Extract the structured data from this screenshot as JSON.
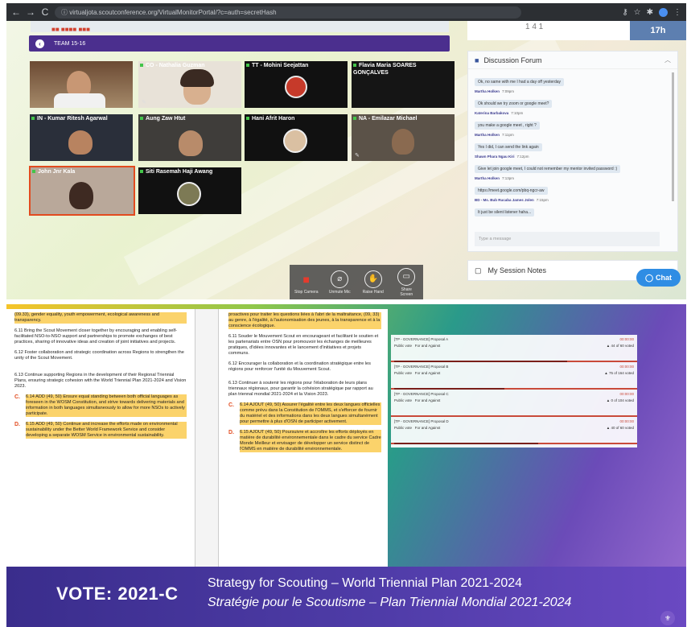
{
  "browser": {
    "back": "←",
    "forward": "→",
    "reload": "C",
    "url": "ⓘ virtualjota.scoutconference.org/VirtualMonitorPortal/?c=auth=secretHash",
    "icons": [
      "key-icon",
      "star-icon",
      "extensions-icon",
      "profile-icon",
      "menu-icon"
    ]
  },
  "top_strip": {
    "text": "■■ ■■■■ ■■■"
  },
  "team_bar": {
    "label": "TEAM 15-16"
  },
  "tiles": [
    {
      "name": "",
      "active": false
    },
    {
      "name": "CO - Nathalia Guzman",
      "active": false
    },
    {
      "name": "TT - Mohini Seejattan",
      "active": false
    },
    {
      "name": "Flavia Maria SOARES GONÇALVES",
      "active": false
    },
    {
      "name": "IN - Kumar Ritesh Agarwal",
      "active": false
    },
    {
      "name": "Aung Zaw Htut",
      "active": false
    },
    {
      "name": "Hani Afrit Haron",
      "active": false
    },
    {
      "name": "NA - Emilazar Michael",
      "active": false
    },
    {
      "name": "John Jnr Kala",
      "active": true
    },
    {
      "name": "Siti Rasemah Haji Awang",
      "active": false
    }
  ],
  "controls": [
    {
      "label": "Stop Camera",
      "icon": "camera-icon"
    },
    {
      "label": "Unmute Mic",
      "icon": "mic-off-icon"
    },
    {
      "label": "Raise Hand",
      "icon": "hand-icon"
    },
    {
      "label": "Share Screen",
      "icon": "screen-icon"
    }
  ],
  "stats": {
    "left": "1 4 1",
    "right": "17h"
  },
  "forum": {
    "title": "Discussion Forum",
    "messages": [
      {
        "who": "",
        "time": "",
        "text": "Ok, no same with me I had a day off yesterday"
      },
      {
        "who": "Martha Holken",
        "time": "7:09pm",
        "text": "Ok should we try zoom or google meet?"
      },
      {
        "who": "Katerina Barbakova",
        "time": "7:10pm",
        "text": "you make a google meet , right ?"
      },
      {
        "who": "Martha Holken",
        "time": "7:11pm",
        "text": "Yes I did, I can send the link again"
      },
      {
        "who": "Shawn Phara Ngau Kiri",
        "time": "7:12pm",
        "text": "Give let join google meet, I could not remember my mentor invited password :)"
      },
      {
        "who": "Martha Holken",
        "time": "7:13pm",
        "text": "https://meet.google.com/pbq-ngcr-aw"
      },
      {
        "who": "BD - Ms. Bub Rucaba James Jolen",
        "time": "7:15pm",
        "text": "It just be silent listener haha..."
      }
    ],
    "placeholder": "Type a message"
  },
  "notes": {
    "label": "My Session Notes"
  },
  "chat": {
    "label": "Chat"
  },
  "doc_left": {
    "p0": "(09.33), gender equality, youth empowerment, ecological awareness and transparency.",
    "p1": "6.11 Bring the Scout Movement closer together by encouraging and enabling self-facilitated NSO-to-NSO support and partnerships to promote exchanges of best practices, sharing of innovative ideas and creation of joint initiatives and projects.",
    "p2": "6.12 Foster collaboration and strategic coordination across Regions to strengthen the unity of the Scout Movement.",
    "p3": "6.13 Continue supporting Regions in the development of their Regional Triennial Plans, ensuring strategic cohesion with the World Triennial Plan 2021-2024 and Vision 2023.",
    "c_letter": "C.",
    "c_text": "6.14 ADD (49, 50) Ensure equal standing between both official languages as foreseen in the WOSM Constitution, and strive towards delivering materials and information in both languages simultaneously to allow for more NSOs to actively participate.",
    "d_letter": "D.",
    "d_text": "6.15 ADD (49, 50) Continue and increase the efforts made on environmental sustainability under the Better World Framework Service and consider developing a separate WOSM Service in environmental sustainability."
  },
  "doc_right": {
    "p0": "proactives pour traiter les questions liées à l'abri de la maltraitance, (09, 33) au genre, à l'égalité, à l'autonomisation des jeunes, à la transparence et à la conscience écologique.",
    "p1": "6.11 Souder le Mouvement Scout en encourageant et facilitant le soutien et les partenariats entre OSN pour promouvoir les échanges de meilleures pratiques, d'idées innovantes et le lancement d'initiatives et projets communs.",
    "p2": "6.12 Encourager la collaboration et la coordination stratégique entre les régions pour renforcer l'unité du Mouvement Scout.",
    "p3": "6.13 Continuer à soutenir les régions pour l'élaboration de leurs plans triennaux régionaux, pour garantir la cohésion stratégique par rapport au plan triennal mondial 2021-2024 et la Vision 2023.",
    "c_letter": "C.",
    "c_text": "6.14 AJOUT (49, 50) Assurer l'égalité entre les deux langues officielles comme prévu dans la Constitution de l'OMMS, et s'efforcer de fournir du matériel et des informations dans les deux langues simultanément pour permettre à plus d'OSN de participer activement.",
    "d_letter": "D.",
    "d_text": "6.15 AJOUT (49, 50) Poursuivre et accroître les efforts déployés en matière de durabilité environnementale dans le cadre du service Cadre Monde Meilleur et envisager de développer un service distinct de l'OMMS en matière de durabilité environnementale."
  },
  "proposals": [
    {
      "title": "[TP - GOVERNANCE] Proposal A",
      "time": "00:00:00",
      "vote": "Public vote",
      "for": "For and Against",
      "count": "▲ 44 of 60 voted",
      "fill": 0.72
    },
    {
      "title": "[TP - GOVERNANCE] Proposal B",
      "time": "00:00:00",
      "vote": "Public vote",
      "for": "For and Against",
      "count": "▲ 75 of 164 voted",
      "fill": 0.46
    },
    {
      "title": "[TP - GOVERNANCE] Proposal C",
      "time": "00:00:00",
      "vote": "Public vote",
      "for": "For and Against",
      "count": "▲ 0 of 104 voted",
      "fill": 0.0
    },
    {
      "title": "[TP - GOVERNANCE] Proposal D",
      "time": "00:00:00",
      "vote": "Public vote",
      "for": "For and Against",
      "count": "▲ 40 of 60 voted",
      "fill": 0.6
    }
  ],
  "vote": {
    "label": "VOTE: 2021-C",
    "title_en": "Strategy for Scouting – World Triennial Plan 2021-2024",
    "title_fr": "Stratégie pour le Scoutisme – Plan Triennial Mondial 2021-2024"
  },
  "colors": {
    "team_bar": "#4b2f8e",
    "accent_red": "#e24b1f",
    "chat_blue": "#2f8de4",
    "vote_bar": "#3a2d8c"
  }
}
